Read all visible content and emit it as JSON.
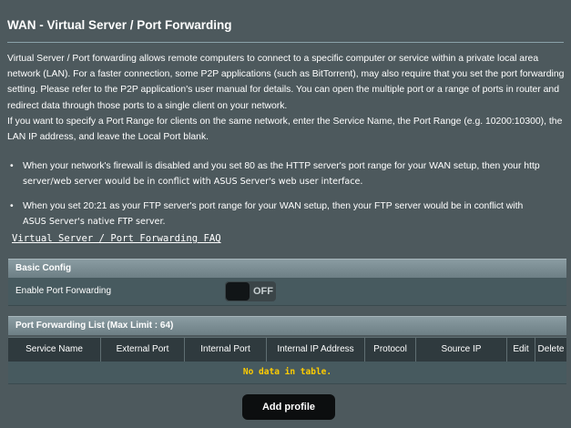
{
  "page": {
    "title": "WAN - Virtual Server / Port Forwarding",
    "description_1": "Virtual Server / Port forwarding allows remote computers to connect to a specific computer or service within a private local area network (LAN). For a faster connection, some P2P applications (such as BitTorrent), may also require that you set the port forwarding setting. Please refer to the P2P application's user manual for details. You can open the multiple port or a range of ports in router and redirect data through those ports to a single client on your network.",
    "description_2": "If you want to specify a Port Range for clients on the same network, enter the Service Name, the Port Range (e.g. 10200:10300), the LAN IP address, and leave the Local Port blank.",
    "bullet_1_line1": "When your network's firewall is disabled and you set 80 as the HTTP server's port range for your WAN setup, then your http",
    "bullet_1_line2": "server/web server would be in conflict with ASUS Server's web user interface.",
    "bullet_2_line1": "When you set 20:21 as your FTP server's port range for your WAN setup, then your FTP server would be in conflict with",
    "bullet_2_line2": "ASUS Server's native FTP server.",
    "bullet_symbol": "•",
    "faq_link": "Virtual Server / Port Forwarding FAQ"
  },
  "basic_config": {
    "header": "Basic Config",
    "enable_label": "Enable Port Forwarding",
    "toggle_state": "OFF",
    "enabled": false
  },
  "port_list": {
    "header": "Port Forwarding List (Max Limit : 64)",
    "columns": [
      "Service Name",
      "External Port",
      "Internal Port",
      "Internal IP Address",
      "Protocol",
      "Source IP",
      "Edit",
      "Delete"
    ],
    "empty_message": "No data in table.",
    "add_button": "Add profile"
  },
  "colors": {
    "background": "#4d595d",
    "table_header": "#2f3a3e",
    "empty_text": "#ffcc00",
    "button": "#0c0e0f"
  }
}
